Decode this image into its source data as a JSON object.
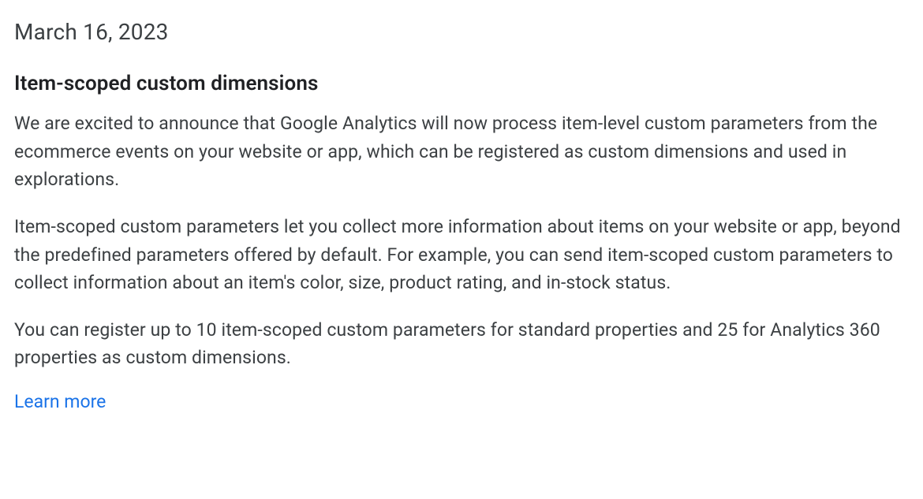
{
  "article": {
    "date": "March 16, 2023",
    "heading": "Item-scoped custom dimensions",
    "paragraphs": [
      "We are excited to announce that Google Analytics will now process item-level custom parameters from the ecommerce events on your website or app, which can be registered as custom dimensions and used in explorations.",
      "Item-scoped custom parameters let you collect more information about items on your website or app, beyond the predefined parameters offered by default. For example, you can send item-scoped custom parameters to collect information about an item's color, size, product rating, and in-stock status.",
      "You can register up to 10 item-scoped custom parameters for standard properties and 25 for Analytics 360 properties as custom dimensions."
    ],
    "link_label": "Learn more"
  }
}
